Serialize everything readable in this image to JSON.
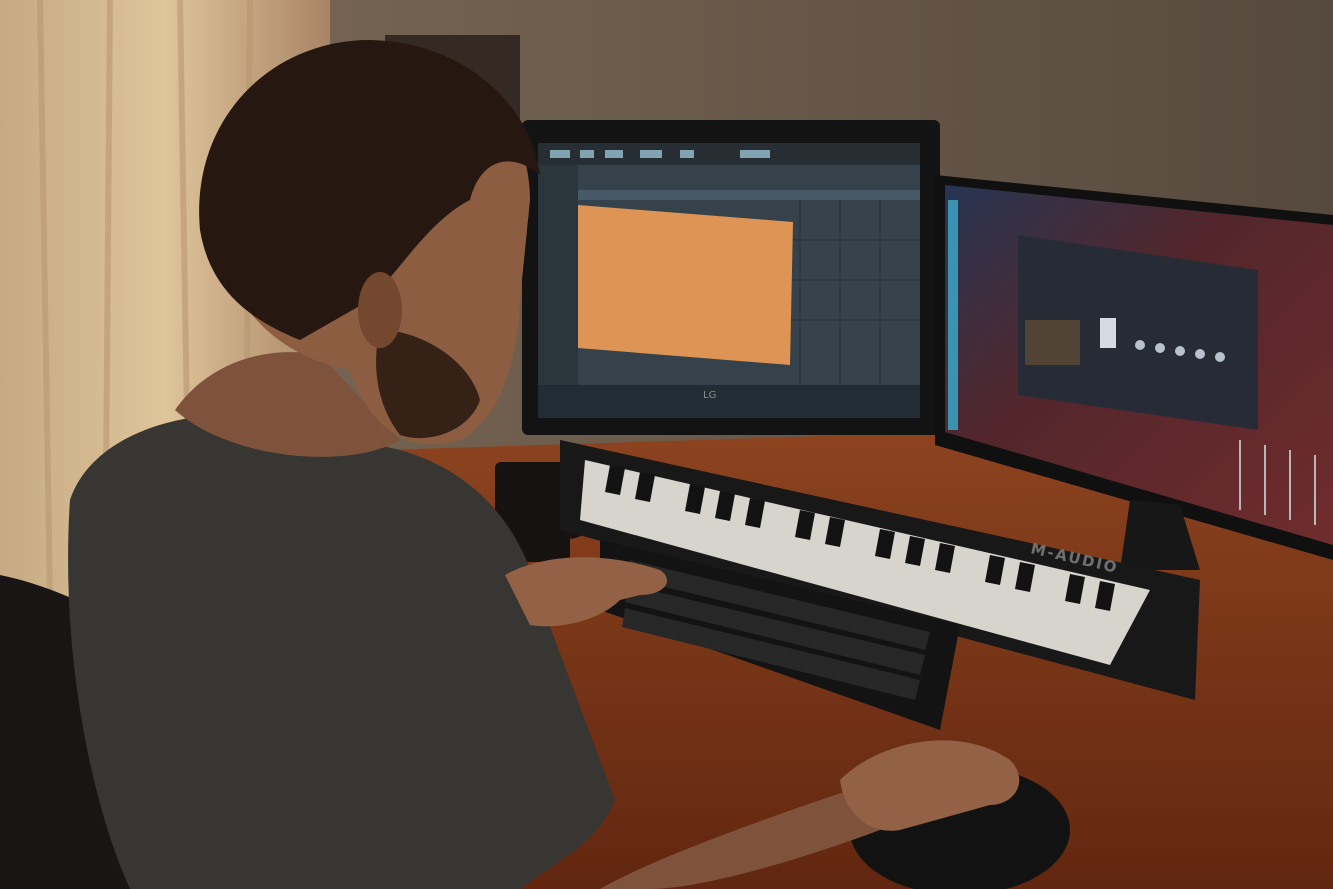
{
  "scene": {
    "description_tag": "photo",
    "keyboard_brand": "M-AUDIO",
    "monitor_logo": "LG",
    "colors": {
      "wall": "#6a5a4c",
      "curtain": "#e8c79a",
      "desk": "#8a3d1c",
      "shirt": "#3d3b37",
      "skin": "#a06a4c",
      "hair": "#2a1a12",
      "orange_clip": "#f0a15c",
      "daw_bg": "#3a4852",
      "right_screen": "#5a2a30"
    }
  }
}
